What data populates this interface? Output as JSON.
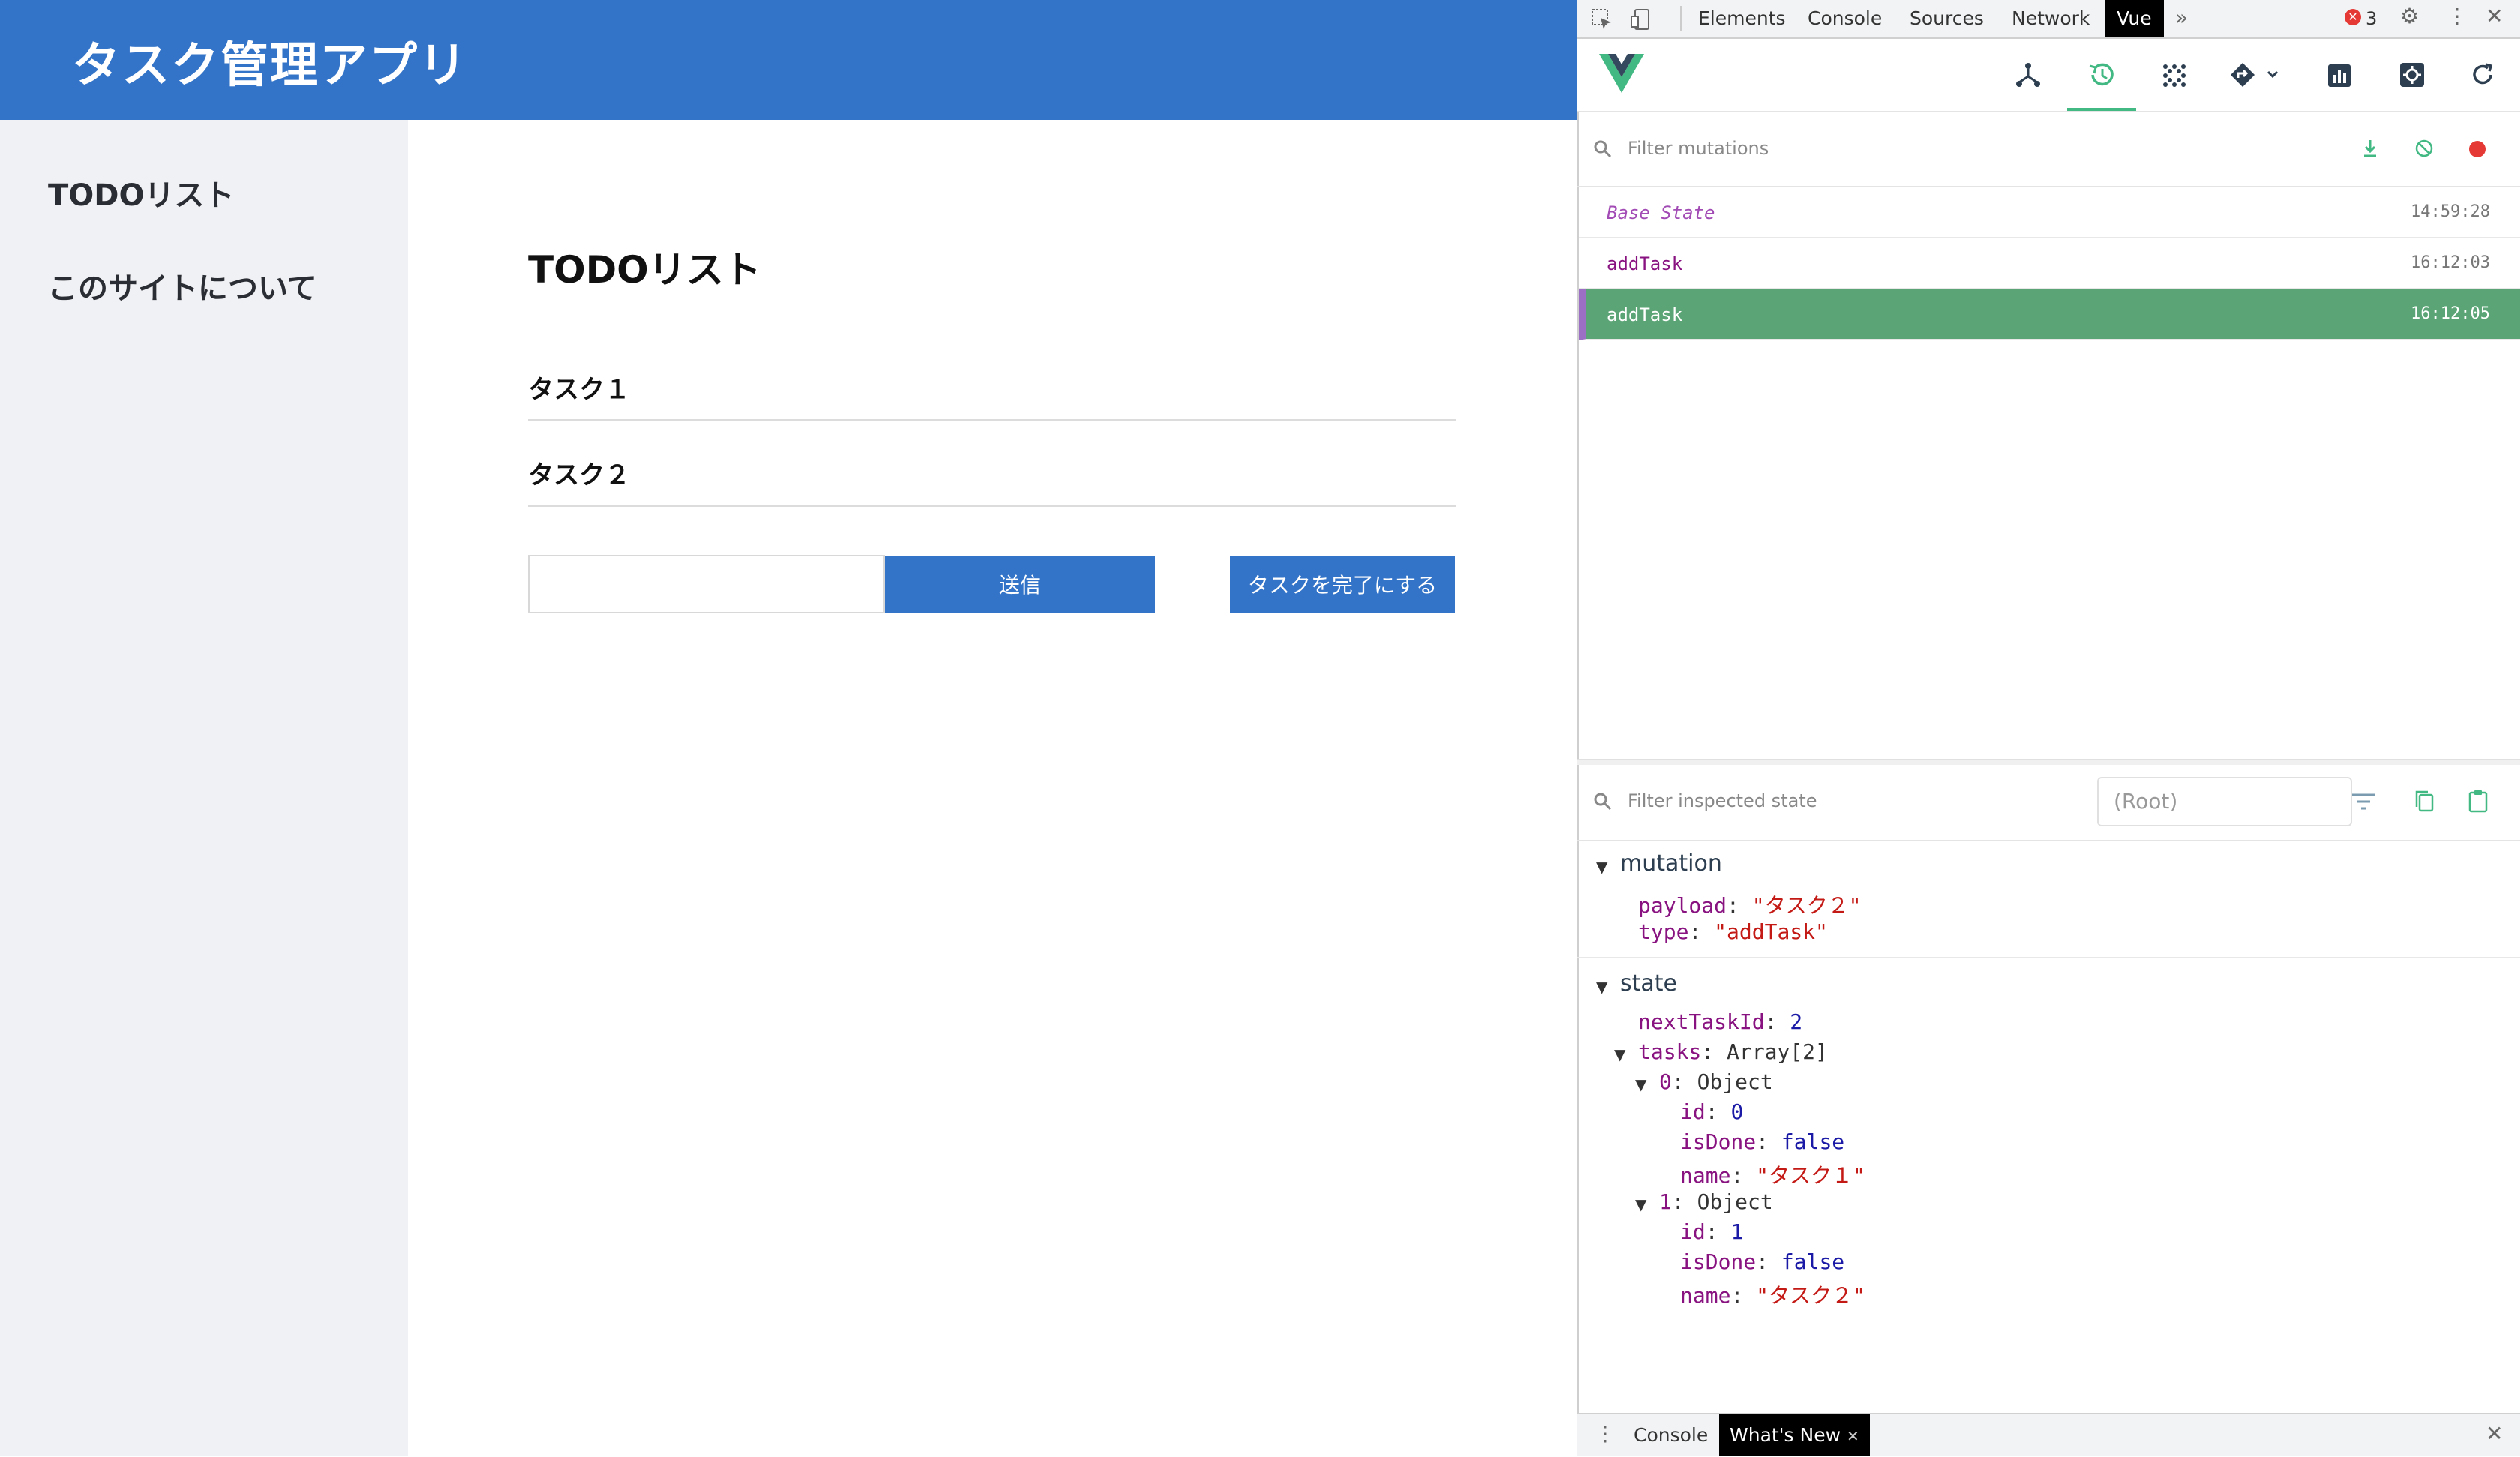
{
  "app": {
    "title": "タスク管理アプリ",
    "sidebar": [
      "TODOリスト",
      "このサイトについて"
    ],
    "heading": "TODOリスト",
    "tasks": [
      "タスク１",
      "タスク２"
    ],
    "input_value": "",
    "send_label": "送信",
    "complete_label": "タスクを完了にする",
    "colors": {
      "brand": "#3474c8",
      "sidebar_bg": "#f0f1f4"
    }
  },
  "devtools": {
    "tabs": [
      "Elements",
      "Console",
      "Sources",
      "Network",
      "Vue"
    ],
    "active_tab": "Vue",
    "more_icon": "chevron-double-right-icon",
    "error_count": "3",
    "vue_toolbar_icons": [
      "components-icon",
      "timeline-icon",
      "vuex-icon",
      "router-icon",
      "performance-icon",
      "settings-icon",
      "refresh-icon"
    ],
    "mutation_filter_placeholder": "Filter mutations",
    "mutations": [
      {
        "name": "Base State",
        "time": "14:59:28"
      },
      {
        "name": "addTask",
        "time": "16:12:03"
      },
      {
        "name": "addTask",
        "time": "16:12:05"
      }
    ],
    "selected_mutation_index": 2,
    "state_filter_placeholder": "Filter inspected state",
    "root_select": "(Root)",
    "inspector": {
      "mutation": {
        "title": "mutation",
        "payload_key": "payload",
        "payload_value": "\"タスク２\"",
        "type_key": "type",
        "type_value": "\"addTask\""
      },
      "state": {
        "title": "state",
        "nextTaskId_key": "nextTaskId",
        "nextTaskId_value": "2",
        "tasks_key": "tasks",
        "tasks_type": "Array[2]",
        "items": [
          {
            "index": "0",
            "type": "Object",
            "id": "0",
            "isDone": "false",
            "name": "\"タスク１\""
          },
          {
            "index": "1",
            "type": "Object",
            "id": "1",
            "isDone": "false",
            "name": "\"タスク２\""
          }
        ]
      }
    },
    "drawer_tabs": [
      "Console",
      "What's New"
    ],
    "colors": {
      "selected_row": "#5aa475",
      "vue_green": "#42b883",
      "key_purple": "#881280",
      "string_red": "#c41a16"
    }
  }
}
